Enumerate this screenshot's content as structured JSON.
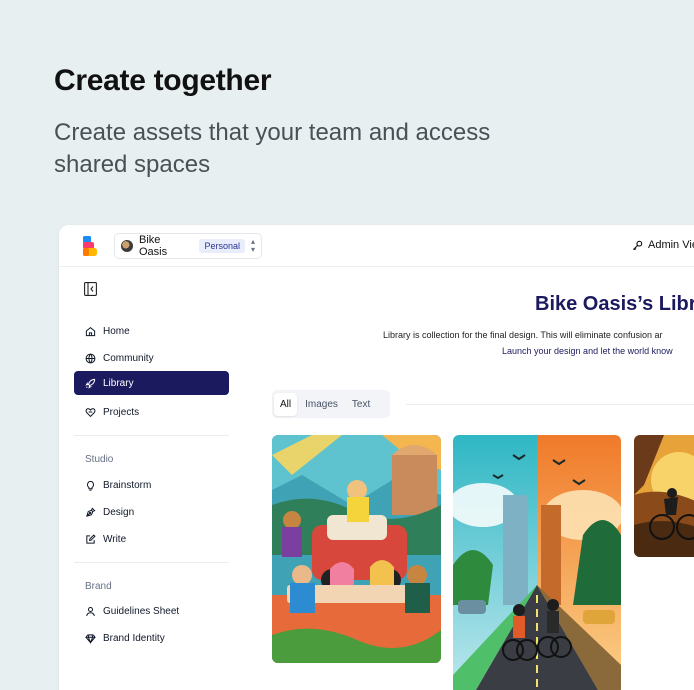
{
  "hero": {
    "title": "Create together",
    "subtitle": "Create assets that your team and access shared spaces"
  },
  "topbar": {
    "workspace_name": "Bike Oasis",
    "workspace_badge": "Personal",
    "admin_label": "Admin Vie"
  },
  "sidebar": {
    "main_items": [
      {
        "label": "Home",
        "icon": "home-icon"
      },
      {
        "label": "Community",
        "icon": "globe-icon"
      },
      {
        "label": "Library",
        "icon": "rocket-icon",
        "active": true
      },
      {
        "label": "Projects",
        "icon": "heart-icon"
      }
    ],
    "studio_label": "Studio",
    "studio_items": [
      {
        "label": "Brainstorm",
        "icon": "lightbulb-icon"
      },
      {
        "label": "Design",
        "icon": "pen-tool-icon"
      },
      {
        "label": "Write",
        "icon": "edit-icon"
      }
    ],
    "brand_label": "Brand",
    "brand_items": [
      {
        "label": "Guidelines Sheet",
        "icon": "user-icon"
      },
      {
        "label": "Brand Identity",
        "icon": "diamond-icon"
      }
    ]
  },
  "library": {
    "title": "Bike Oasis’s Libra",
    "description": "Library is collection for the final design. This will eliminate confusion ar",
    "link": "Launch your design and let the world know"
  },
  "tabs": [
    "All",
    "Images",
    "Text"
  ],
  "colors": {
    "background": "#e8eff0",
    "accent": "#1c1a5e",
    "badge_bg": "#e8ecfb"
  }
}
